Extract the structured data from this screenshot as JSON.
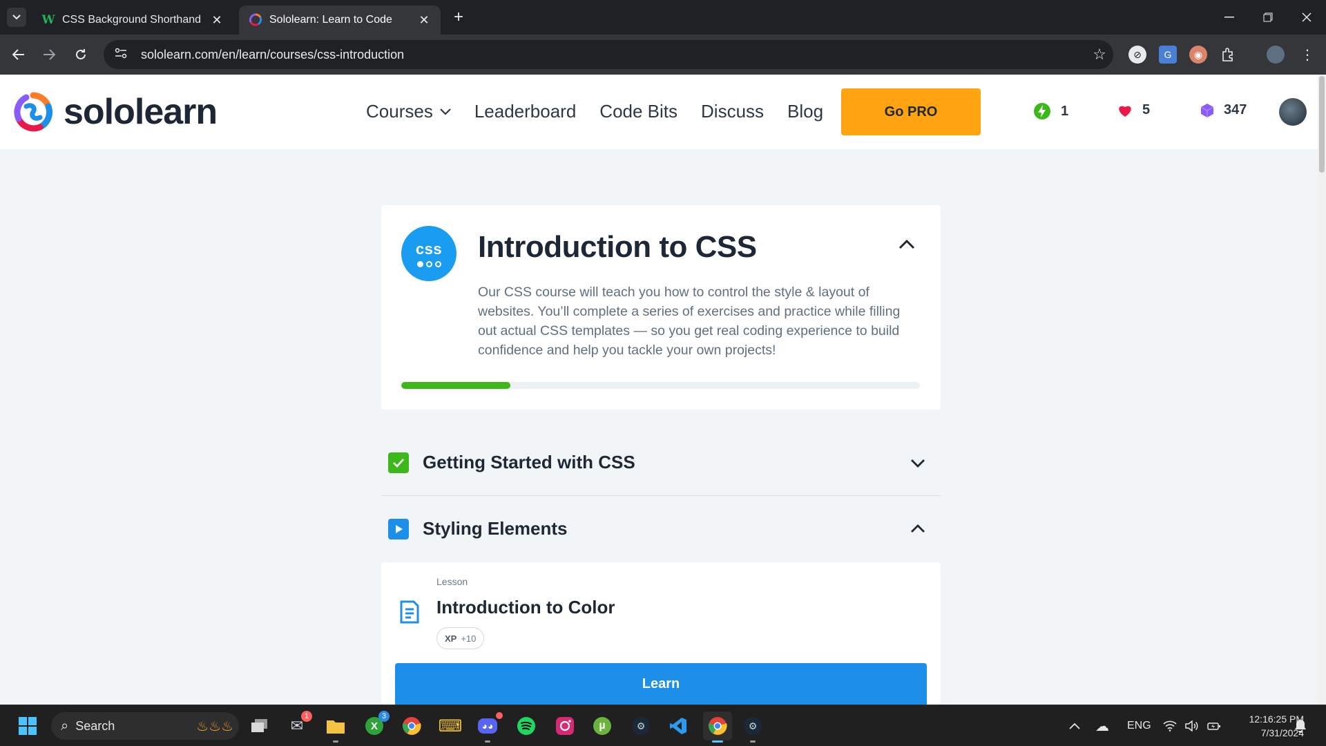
{
  "browser": {
    "tabs": [
      {
        "title": "CSS Background Shorthand",
        "active": false
      },
      {
        "title": "Sololearn: Learn to Code",
        "active": true
      }
    ],
    "url": "sololearn.com/en/learn/courses/css-introduction"
  },
  "header": {
    "logo_text": "sololearn",
    "nav": [
      "Courses",
      "Leaderboard",
      "Code Bits",
      "Discuss",
      "Blog"
    ],
    "gopro_label": "Go PRO",
    "streak": "1",
    "hearts": "5",
    "bits": "347"
  },
  "course": {
    "badge_text": "css",
    "title": "Introduction to CSS",
    "description": "Our CSS course will teach you how to control the style & layout of websites. You’ll complete a series of exercises and practice while filling out actual CSS templates — so you get real coding experience to build confidence and help you tackle your own projects!",
    "progress_fraction": 0.21
  },
  "modules": [
    {
      "title": "Getting Started with CSS",
      "status": "completed",
      "expanded": false
    },
    {
      "title": "Styling Elements",
      "status": "in-progress",
      "expanded": true
    }
  ],
  "lesson": {
    "type": "Lesson",
    "title": "Introduction to Color",
    "xp_label": "XP",
    "xp_value": "+10",
    "button_label": "Learn"
  },
  "taskbar": {
    "search_placeholder": "Search",
    "language": "ENG",
    "time": "12:16:25 PM",
    "date": "7/31/2024",
    "badges": {
      "mail": "1",
      "xbox": "3"
    }
  },
  "colors": {
    "accent_blue": "#1d8fe8",
    "gopro_orange": "#ffa310",
    "progress_green": "#3db81a",
    "heart_red": "#e8194b",
    "bit_purple": "#8a5cf6"
  }
}
